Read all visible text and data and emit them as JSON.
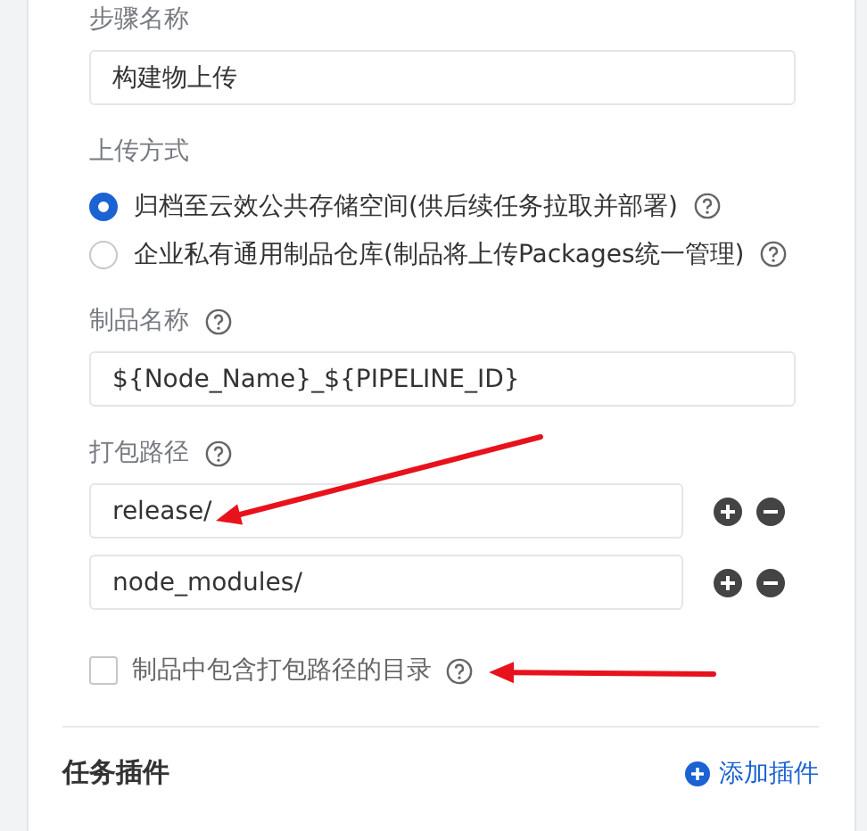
{
  "step_name": {
    "label": "步骤名称",
    "value": "构建物上传"
  },
  "upload_method": {
    "label": "上传方式",
    "options": [
      {
        "label": "归档至云效公共存储空间(供后续任务拉取并部署)",
        "selected": true
      },
      {
        "label": "企业私有通用制品仓库(制品将上传Packages统一管理)",
        "selected": false
      }
    ]
  },
  "artifact_name": {
    "label": "制品名称",
    "value": "${Node_Name}_${PIPELINE_ID}"
  },
  "package_paths": {
    "label": "打包路径",
    "values": [
      "release/",
      "node_modules/"
    ]
  },
  "include_dir": {
    "label": "制品中包含打包路径的目录",
    "checked": false
  },
  "plugins": {
    "title": "任务插件",
    "add_label": "添加插件"
  }
}
